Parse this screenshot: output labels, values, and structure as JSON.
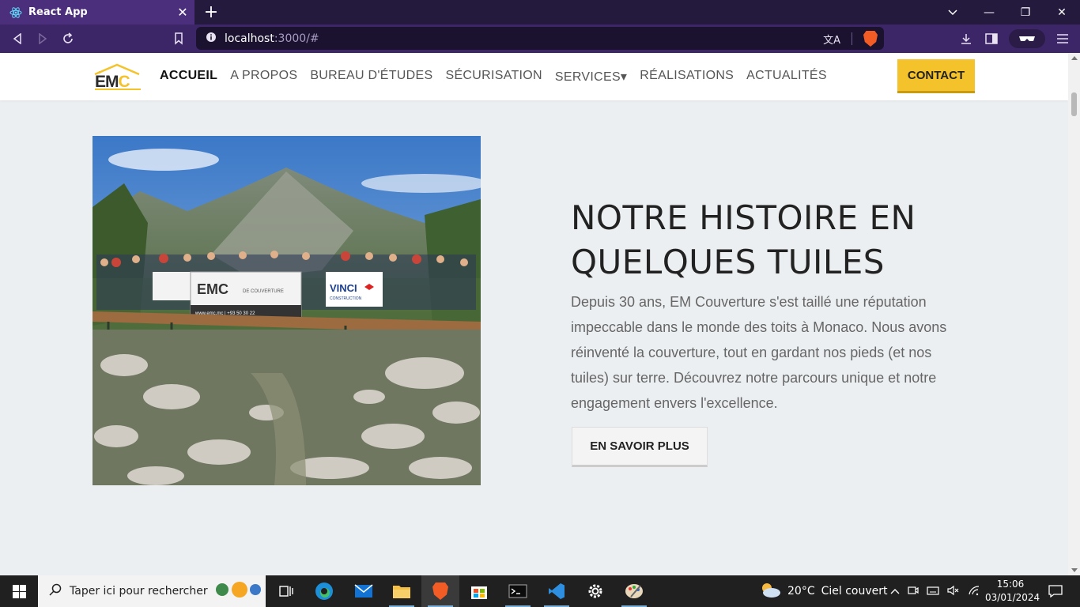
{
  "browser": {
    "tab_title": "React App",
    "url_host": "localhost",
    "url_rest": ":3000/#",
    "window_controls": {
      "minimize": "—",
      "maximize": "❐",
      "close": "✕"
    },
    "icons": [
      "back-icon",
      "forward-icon",
      "reload-icon",
      "bookmark-icon",
      "translate-icon",
      "brave-shield-icon",
      "download-icon",
      "sidebar-icon",
      "wallet-icon",
      "menu-icon"
    ]
  },
  "site": {
    "logo": {
      "text_main": "EM",
      "text_accent": "C"
    },
    "nav": [
      {
        "label": "ACCUEIL",
        "active": true
      },
      {
        "label": "A PROPOS"
      },
      {
        "label": "BUREAU D'ÉTUDES"
      },
      {
        "label": "SÉCURISATION"
      },
      {
        "label": "SERVICES▾"
      },
      {
        "label": "RÉALISATIONS"
      },
      {
        "label": "ACTUALITÉS"
      }
    ],
    "contact_label": "CONTACT",
    "hero": {
      "heading": "NOTRE HISTOIRE EN QUELQUES TUILES",
      "paragraph": "Depuis 30 ans, EM Couverture s'est taillé une réputation impeccable dans le monde des toits à Monaco. Nous avons réinventé la couverture, tout en gardant nos pieds (et nos tuiles) sur terre. Découvrez notre parcours unique et notre engagement envers l'excellence.",
      "button_label": "EN SAVOIR PLUS",
      "photo_banners": {
        "emc": "EMC",
        "emc_sub": "DE COUVERTURE",
        "emc_contact": "www.emc.mc | +93 50 30 22",
        "vinci": "VINCI",
        "vinci_sub": "CONSTRUCTION"
      }
    }
  },
  "taskbar": {
    "search_placeholder": "Taper ici pour rechercher",
    "weather_temp": "20°C",
    "weather_text": "Ciel couvert",
    "time": "15:06",
    "date": "03/01/2024"
  },
  "colors": {
    "accent_yellow": "#f4c22b",
    "browser_purple": "#3d2668"
  }
}
